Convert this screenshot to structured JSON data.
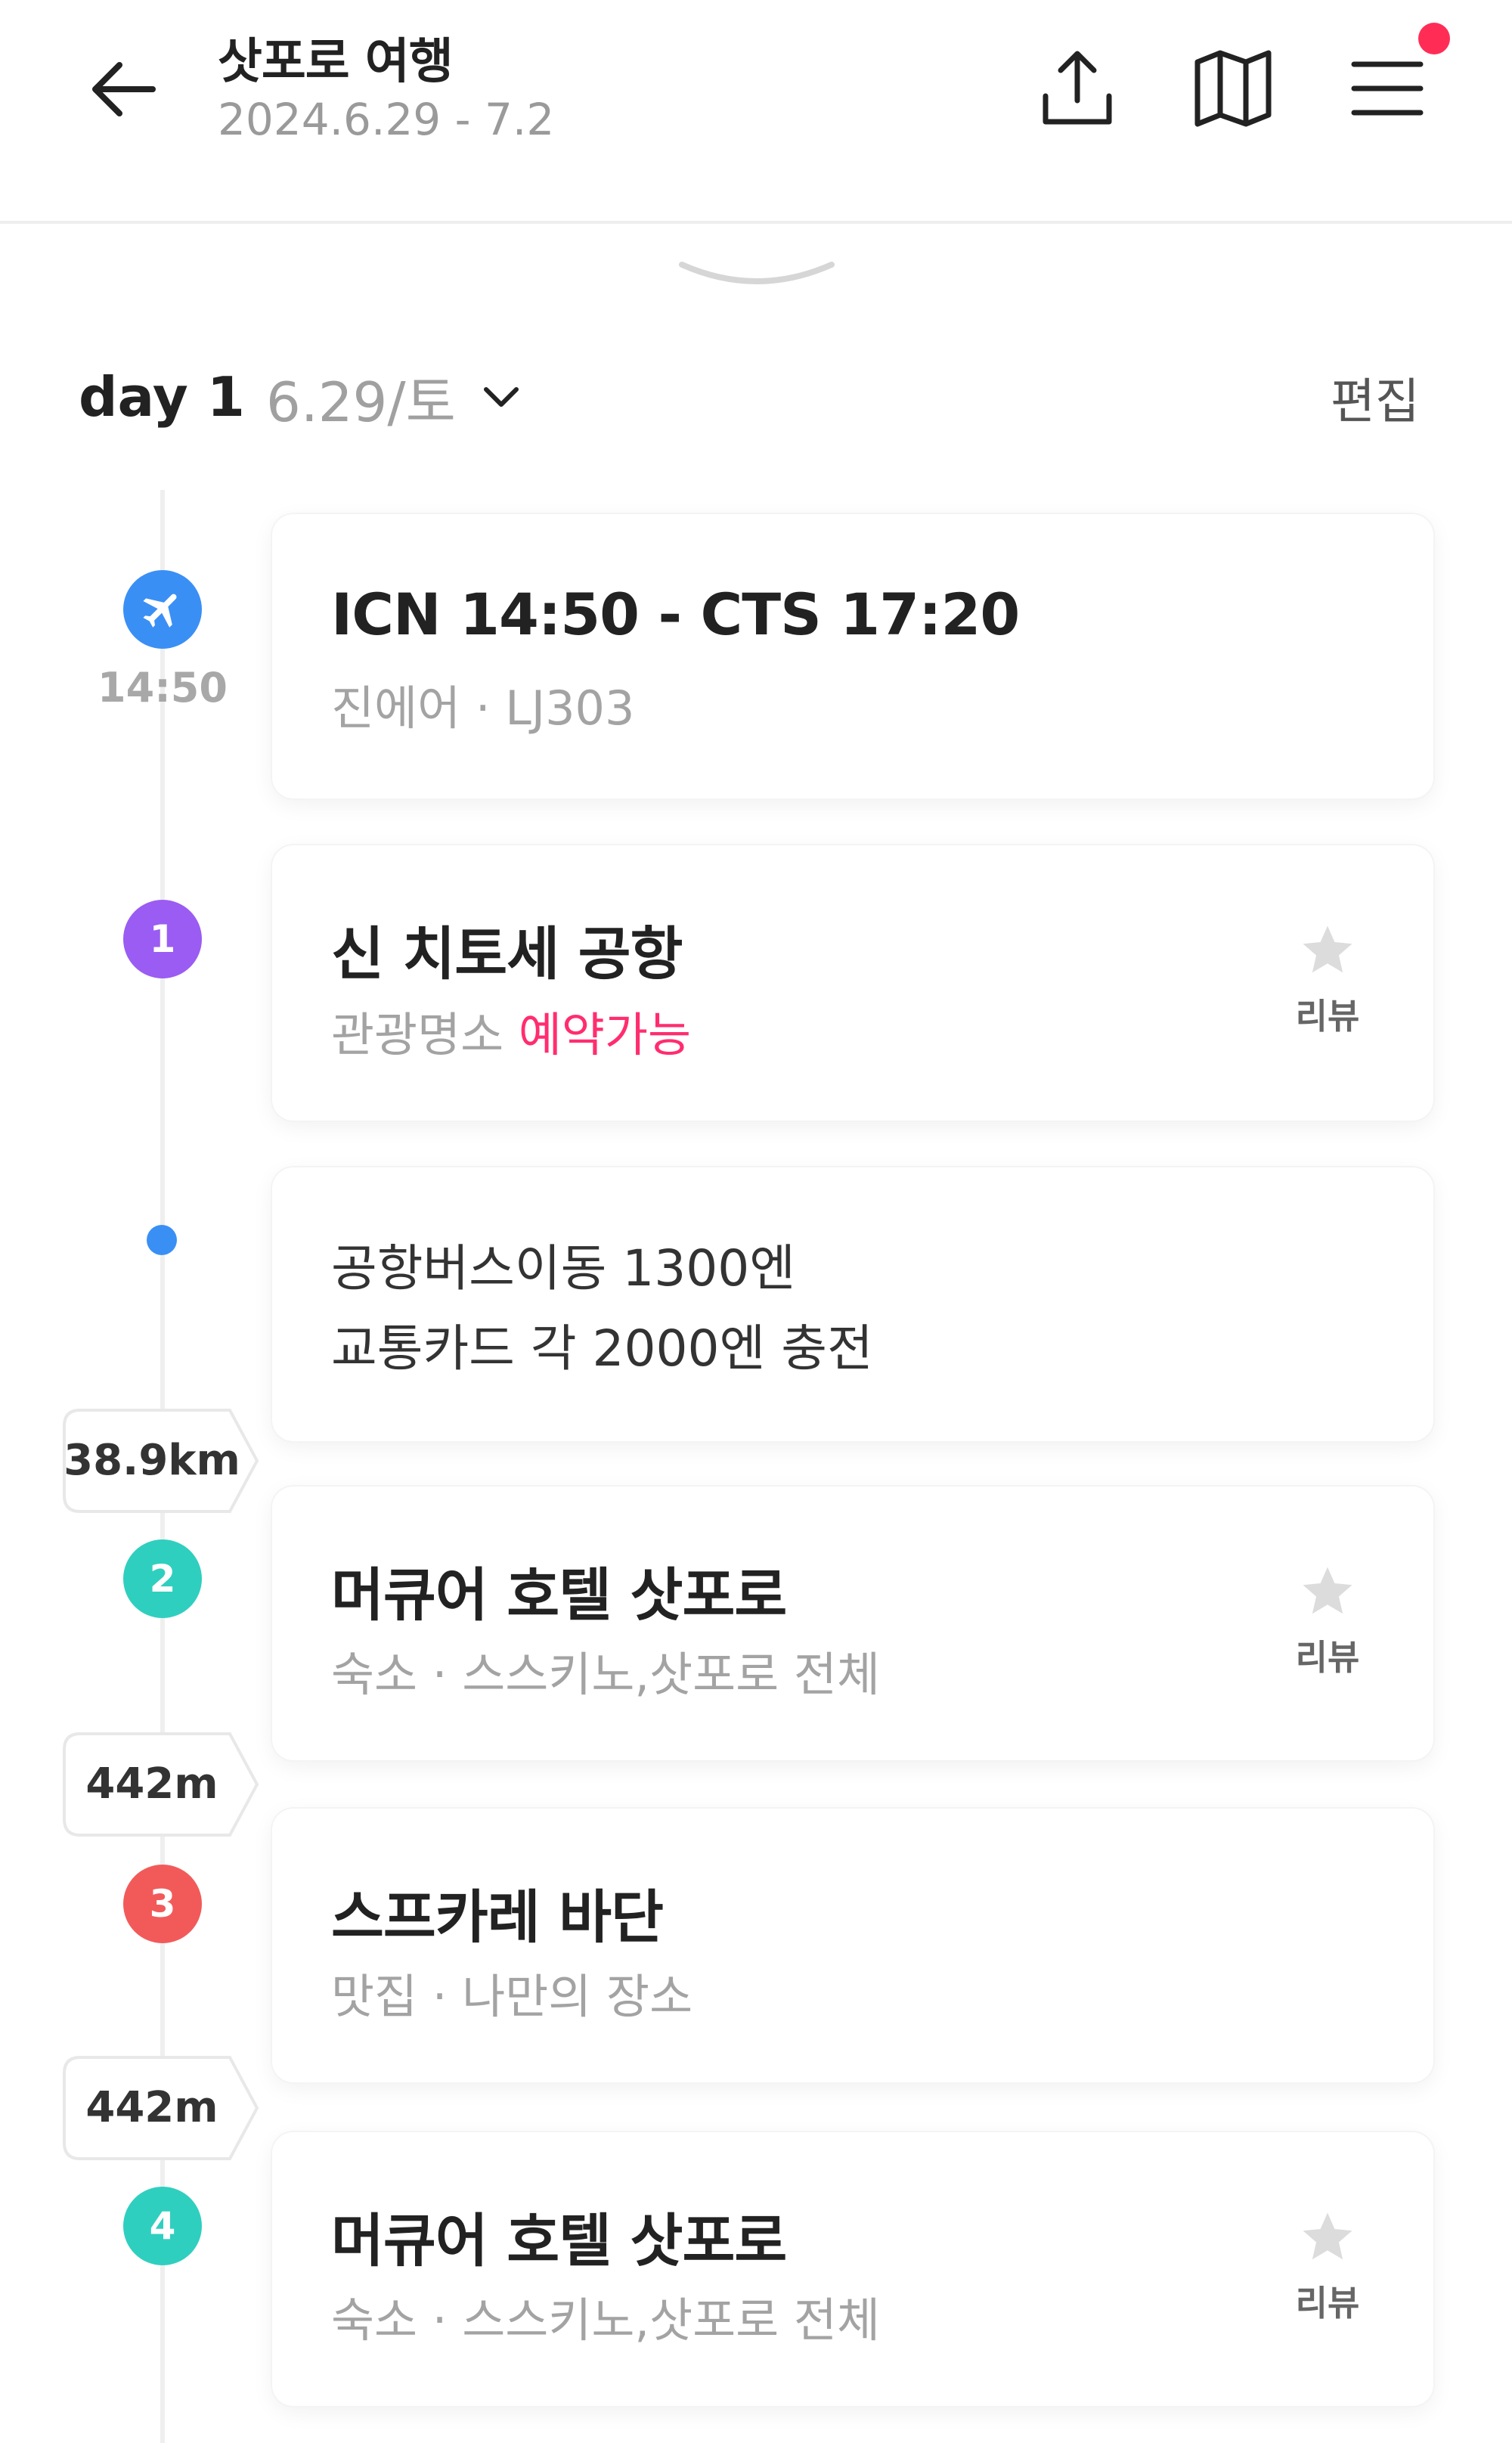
{
  "header": {
    "title": "삿포로 여행",
    "dates": "2024.6.29 - 7.2"
  },
  "day": {
    "label": "day 1",
    "date": "6.29/토",
    "edit_label": "편집"
  },
  "timeline": [
    {
      "marker": "plane-icon",
      "time": "14:50",
      "title": "ICN 14:50 - CTS 17:20",
      "subtitle": "진에어 · LJ303"
    },
    {
      "marker": "1",
      "marker_color": "#9a5cf2",
      "title": "신 치토세 공항",
      "category": "관광명소",
      "badge": "예약가능",
      "review_label": "리뷰"
    },
    {
      "memo_lines": [
        "공항버스이동 1300엔",
        "교통카드 각 2000엔 충전"
      ]
    },
    {
      "distance": "38.9km"
    },
    {
      "marker": "2",
      "marker_color": "#2fcfbf",
      "title": "머큐어 호텔 삿포로",
      "subtitle": "숙소 · 스스키노,삿포로 전체",
      "review_label": "리뷰"
    },
    {
      "distance": "442m"
    },
    {
      "marker": "3",
      "marker_color": "#f25a5a",
      "title": "스프카레 바단",
      "subtitle": "맛집 · 나만의 장소"
    },
    {
      "distance": "442m"
    },
    {
      "marker": "4",
      "marker_color": "#2fcfbf",
      "title": "머큐어 호텔 삿포로",
      "subtitle": "숙소 · 스스키노,삿포로 전체",
      "review_label": "리뷰"
    }
  ],
  "colors": {
    "accent_pink": "#ff2d6f",
    "notification_dot": "#ff2d55",
    "plane_marker": "#3a8ff5",
    "memo_dot": "#3a8ff5"
  },
  "icons": {
    "back": "arrow-left-icon",
    "share": "share-upload-icon",
    "map": "map-icon",
    "menu": "hamburger-menu-icon",
    "collapse": "chevron-down-handle-icon",
    "review": "star-icon"
  }
}
